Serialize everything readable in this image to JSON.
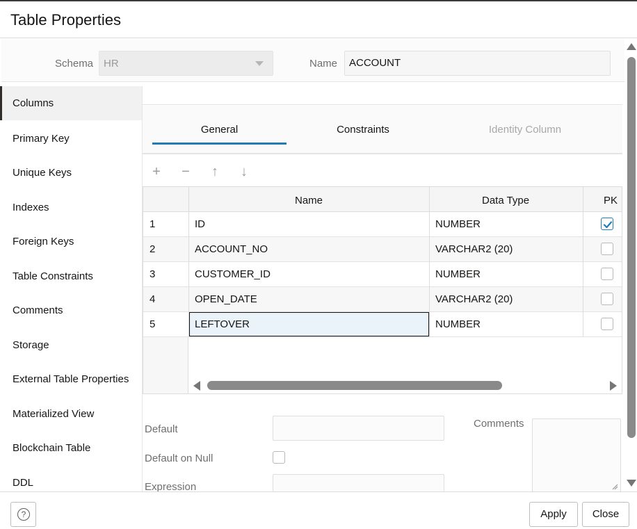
{
  "dialog": {
    "title": "Table Properties"
  },
  "header": {
    "schema_label": "Schema",
    "schema_value": "HR",
    "name_label": "Name",
    "name_value": "ACCOUNT"
  },
  "nav": {
    "items": [
      {
        "label": "Columns",
        "active": true
      },
      {
        "label": "Primary Key"
      },
      {
        "label": "Unique Keys"
      },
      {
        "label": "Indexes"
      },
      {
        "label": "Foreign Keys"
      },
      {
        "label": "Table Constraints"
      },
      {
        "label": "Comments"
      },
      {
        "label": "Storage"
      },
      {
        "label": "External Table Properties"
      },
      {
        "label": "Materialized View"
      },
      {
        "label": "Blockchain Table"
      },
      {
        "label": "DDL"
      }
    ]
  },
  "tabs": [
    {
      "label": "General",
      "selected": true
    },
    {
      "label": "Constraints"
    },
    {
      "label": "Identity Column",
      "disabled": true
    }
  ],
  "toolbar": {
    "add_icon": "+",
    "remove_icon": "−",
    "up_icon": "↑",
    "down_icon": "↓"
  },
  "grid": {
    "headers": {
      "name": "Name",
      "type": "Data Type",
      "pk": "PK"
    },
    "rows": [
      {
        "n": "1",
        "name": "ID",
        "type": "NUMBER",
        "pk": true
      },
      {
        "n": "2",
        "name": "ACCOUNT_NO",
        "type": "VARCHAR2 (20)",
        "pk": false
      },
      {
        "n": "3",
        "name": "CUSTOMER_ID",
        "type": "NUMBER",
        "pk": false
      },
      {
        "n": "4",
        "name": "OPEN_DATE",
        "type": "VARCHAR2 (20)",
        "pk": false
      },
      {
        "n": "5",
        "name": "LEFTOVER",
        "type": "NUMBER",
        "pk": false
      }
    ]
  },
  "form": {
    "default_label": "Default",
    "default_on_null_label": "Default on Null",
    "expression_label": "Expression",
    "comments_label": "Comments"
  },
  "footer": {
    "help_label": "?",
    "apply_label": "Apply",
    "close_label": "Close"
  },
  "colors": {
    "accent": "#227cb4",
    "selected_cell_bg": "#e9f3f9"
  }
}
